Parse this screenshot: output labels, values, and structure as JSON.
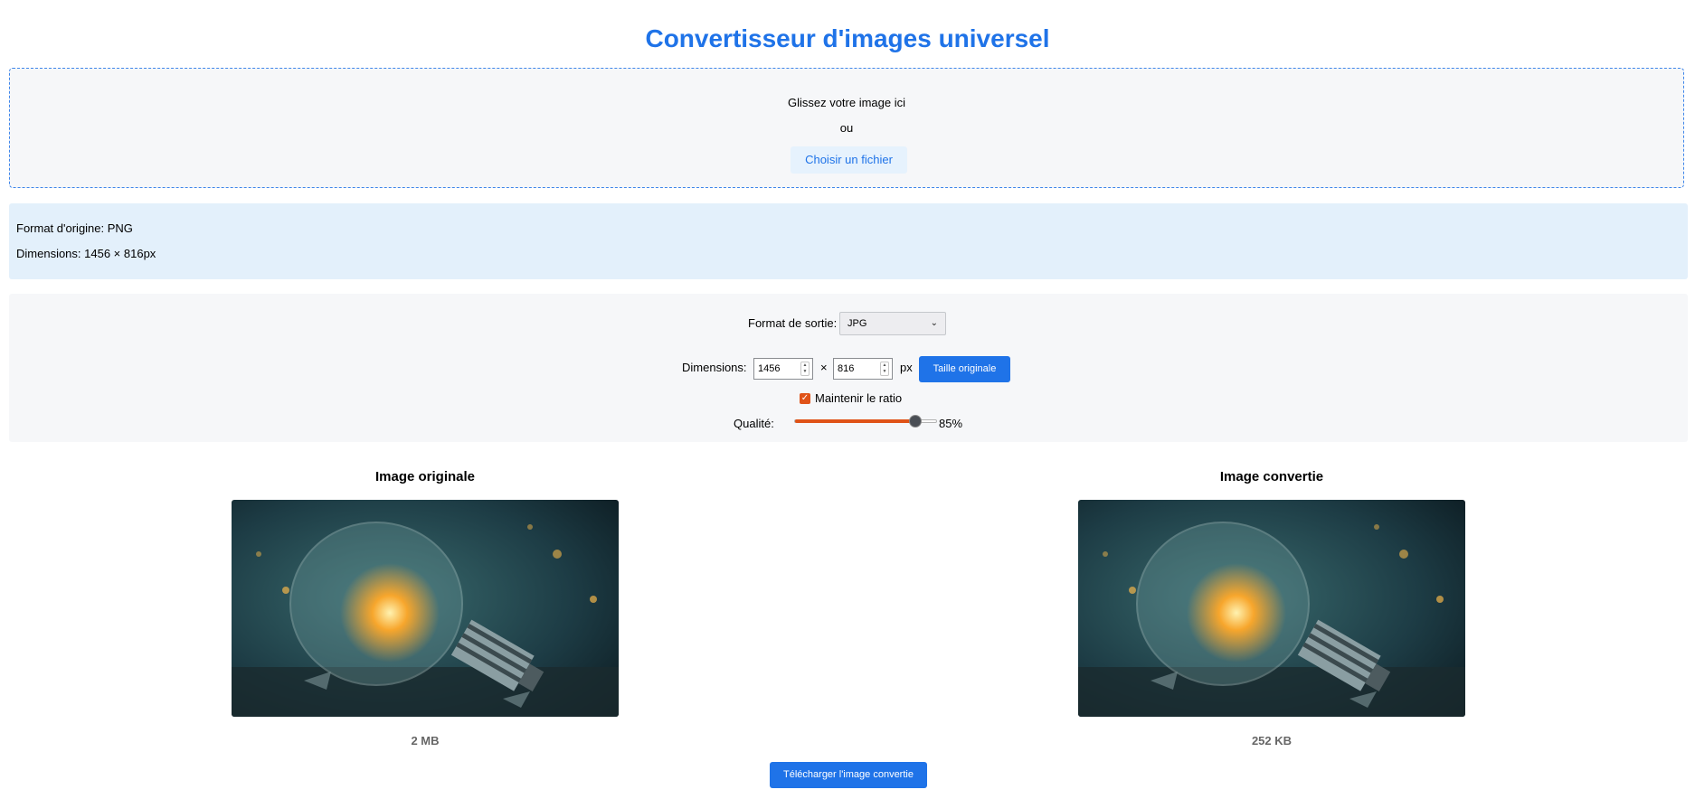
{
  "page": {
    "title": "Convertisseur d'images universel"
  },
  "dropzone": {
    "line1": "Glissez votre image ici",
    "line2": "ou",
    "choose_button": "Choisir un fichier"
  },
  "info": {
    "format_line": "Format d'origine: PNG",
    "dimensions_line": "Dimensions: 1456 × 816px"
  },
  "settings": {
    "format_label": "Format de sortie:",
    "format_value": "JPG",
    "dimensions_label": "Dimensions:",
    "width_value": "1456",
    "times_symbol": "×",
    "height_value": "816",
    "unit": "px",
    "original_size_button": "Taille originale",
    "keep_ratio_label": "Maintenir le ratio",
    "keep_ratio_checked": true,
    "quality_label": "Qualité:",
    "quality_value": "85%",
    "quality_fraction": 0.85
  },
  "preview": {
    "original_title": "Image originale",
    "original_size": "2 MB",
    "converted_title": "Image convertie",
    "converted_size": "252 KB"
  },
  "download_button": "Télécharger l'image convertie",
  "colors": {
    "accent": "#1f73e8",
    "slider": "#e05318"
  }
}
